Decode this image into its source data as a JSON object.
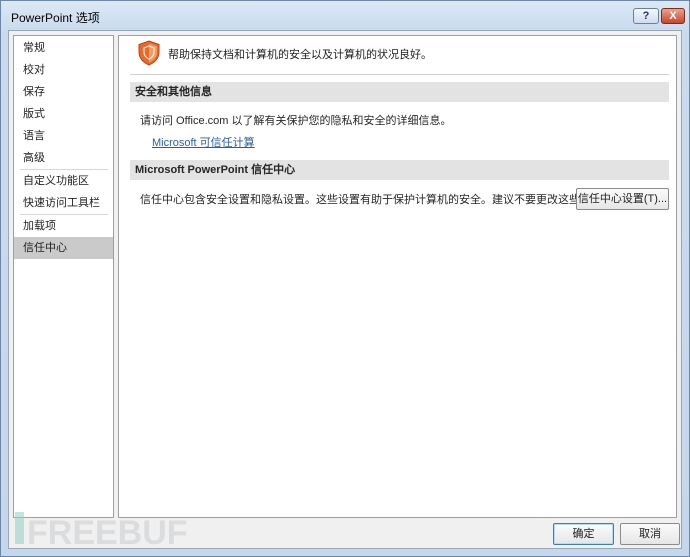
{
  "window": {
    "title": "PowerPoint 选项",
    "help_label": "?",
    "close_label": "X"
  },
  "sidebar": {
    "items": [
      {
        "label": "常规",
        "selected": false
      },
      {
        "label": "校对",
        "selected": false
      },
      {
        "label": "保存",
        "selected": false
      },
      {
        "label": "版式",
        "selected": false
      },
      {
        "label": "语言",
        "selected": false
      },
      {
        "label": "高级",
        "selected": false
      },
      {
        "label": "自定义功能区",
        "selected": false
      },
      {
        "label": "快速访问工具栏",
        "selected": false
      },
      {
        "label": "加载项",
        "selected": false
      },
      {
        "label": "信任中心",
        "selected": true
      }
    ]
  },
  "main": {
    "header_text": "帮助保持文档和计算机的安全以及计算机的状况良好。",
    "header_icon": "shield-icon",
    "section1": {
      "title": "安全和其他信息",
      "text": "请访问 Office.com  以了解有关保护您的隐私和安全的详细信息。",
      "link": "Microsoft 可信任计算"
    },
    "section2": {
      "title": "Microsoft PowerPoint 信任中心",
      "text": "信任中心包含安全设置和隐私设置。这些设置有助于保护计算机的安全。建议不要更改这些设置。",
      "button": "信任中心设置(T)..."
    }
  },
  "footer": {
    "ok_label": "确定",
    "cancel_label": "取消"
  },
  "watermark": {
    "text": "FREEBUF"
  },
  "colors": {
    "shield_orange": "#e8692c",
    "link_blue": "#2a5fa8",
    "selected_bg": "#cacaca"
  }
}
